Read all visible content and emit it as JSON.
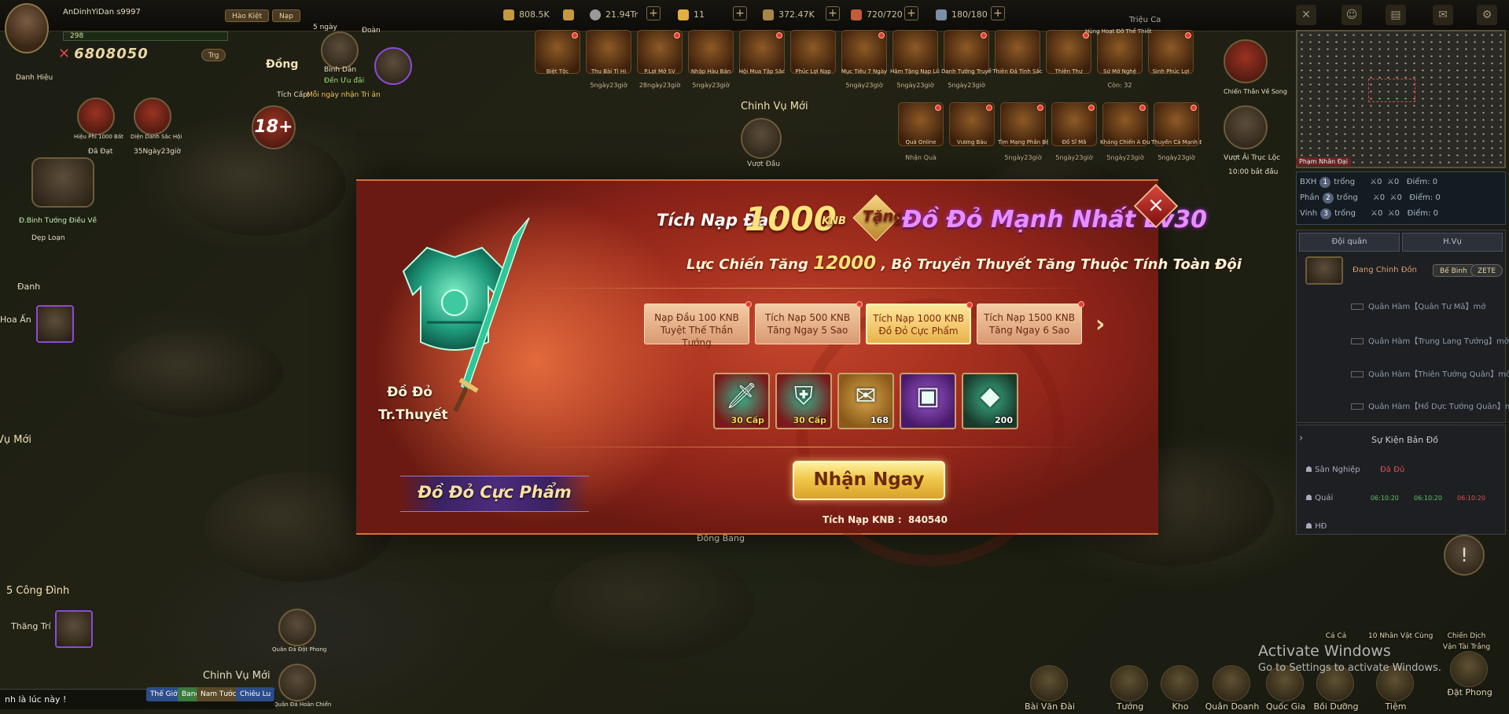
{
  "player": {
    "name": "AnDinhYiDan s9997",
    "level": "298",
    "power": "6808050",
    "tabs": [
      "Hào Kiệt",
      "Nạp"
    ],
    "title_btn": "Danh Hiệu",
    "power_btn": "Trg"
  },
  "resources": [
    {
      "value": "808.5K"
    },
    {
      "value": "21.94Tr"
    },
    {
      "value": "11"
    },
    {
      "value": "372.47K"
    },
    {
      "value": "720/720"
    },
    {
      "value": "180/180"
    }
  ],
  "left_labels": {
    "dong": "Đồng",
    "binh_dan": "Bình Dân",
    "uu_dai": "Đến Ưu đãi",
    "gift_note": "Mỗi ngày nhận Tri ân",
    "tich_cap": "Tích Cấp:",
    "ngay": "5 ngày",
    "doan": "Đoàn",
    "hero1": "Hiệu Phi 1000 Bất",
    "hero1_sub": "Đã Đạt",
    "hero2": "Diện Danh Sắc Hội",
    "hero2_sub": "35Ngày23giờ",
    "bang": "Đ.Binh Tướng Điều Về",
    "dep_loan": "Dẹp Loạn",
    "danh": "Đanh",
    "hoa_an": "Hoa Ấn",
    "chinh_vu_moi": "Chinh Vụ Mới",
    "vu_moi": "Vụ Mới",
    "cong_dinh": "Công Đình",
    "num5": "5",
    "thang_tri": "Thăng Trí",
    "quan_da_dot": "Quân Đá Đột Phong",
    "chinh_vu_moi2": "Chinh Vụ Mới",
    "quan_da_hoan": "Quân Đá Hoàn Chiến",
    "age": "18+",
    "vuot_dau": "Vượt Đầu"
  },
  "top_icons": {
    "row1": [
      {
        "label": "Biệt Tộc",
        "time": ""
      },
      {
        "label": "Thu Bài Tì Hi",
        "time": "5ngày23giờ"
      },
      {
        "label": "P.Lợi Mở SV",
        "time": "28ngày23giờ"
      },
      {
        "label": "Nhập Hàu Bán",
        "time": "5ngày23giờ"
      },
      {
        "label": "Hội Mua Tập Sắc",
        "time": ""
      },
      {
        "label": "Phúc Lợi Nạp",
        "time": ""
      },
      {
        "label": "Mục Tiêu 7 Ngày",
        "time": "5ngày23giờ"
      },
      {
        "label": "Hãm Tặng Nạp Lũ Kế",
        "time": "5ngày23giờ"
      },
      {
        "label": "Danh Tướng Truyền",
        "time": "5ngày23giờ"
      },
      {
        "label": "Thiên Đá Tinh Sắc",
        "time": ""
      },
      {
        "label": "Thiên Thư",
        "time": ""
      },
      {
        "label": "Sứ Mở Nghệ",
        "time": "Còn: 32"
      },
      {
        "label": "Sinh Phúc Lợi",
        "time": ""
      }
    ],
    "row1_extra": "Hùng Hoạt Đỡ Thể Thiết",
    "row2": [
      {
        "label": "Quà Online",
        "time": "Nhận Quà"
      },
      {
        "label": "Vương Bàu",
        "time": ""
      },
      {
        "label": "Tìm Mạng Phần Bện",
        "time": "5ngày23giờ"
      },
      {
        "label": "Đồ Sĩ Mã",
        "time": "5ngày23giờ"
      },
      {
        "label": "Kháng Chiến Á Đuổi",
        "time": "5ngày23giờ"
      },
      {
        "label": "Thuyền Cá Mạnh Bận",
        "time": "5ngày23giờ"
      }
    ],
    "right1": {
      "label": "Chiến Thắn Về Song",
      "time": ""
    },
    "right2": {
      "label": "Vượt Ải Trục Lộc",
      "time": "10:00 bắt đầu"
    },
    "dong_bang": "Đồng Bang",
    "trieu_ca": "Triệu Ca"
  },
  "minimap": {
    "btn": "Phạm Nhân Đại"
  },
  "rank": {
    "headers": [
      "BXH",
      "Phần",
      "Vinh"
    ],
    "rows": [
      {
        "n": "1",
        "name": "trống",
        "a": "0",
        "b": "0",
        "c": "Điểm: 0"
      },
      {
        "n": "2",
        "name": "trống",
        "a": "0",
        "b": "0",
        "c": "Điểm: 0"
      },
      {
        "n": "3",
        "name": "trống",
        "a": "0",
        "b": "0",
        "c": "Điểm: 0"
      }
    ]
  },
  "side_tabs": [
    "Đội quân",
    "H.Vụ"
  ],
  "army": {
    "title": "Đang Chinh Đồn",
    "btn1": "Bế Binh",
    "btn2": "ZETE",
    "items": [
      "Quân Hàm【Quân Tư Mã】mở",
      "Quân Hàm【Trung Lang Tướng】mở",
      "Quân Hàm【Thiên Tướng Quân】mở",
      "Quân Hàm【Hổ Dực Tướng Quân】mở"
    ]
  },
  "events": {
    "title": "Sự Kiện Bản Đồ",
    "rows": [
      {
        "label": "Sân Nghiệp",
        "v1": "Đã Đủ",
        "v2": "",
        "v3": ""
      },
      {
        "label": "Quái",
        "v1": "06:10:20",
        "v2": "06:10:20",
        "v3": "06:10:20"
      },
      {
        "label": "HĐ",
        "v1": "",
        "v2": "",
        "v3": ""
      }
    ]
  },
  "chat": {
    "text": "nh là lúc này !",
    "btns": [
      "Thế Giới",
      "Bang",
      "Nam Tước",
      "Chiêu Lu"
    ]
  },
  "bottom_bar": [
    "Bài Văn Đài",
    "Tướng",
    "Kho",
    "Quân Doanh",
    "Quốc Gia",
    "Bồi Dưỡng",
    "Tiệm",
    "Đặt Phong",
    "Chiến Dịch",
    "Vận Tài Trắng",
    "Cá Cả",
    "10 Nhân Vật Cùng"
  ],
  "modal": {
    "title_pre": "Tích Nạp Đạt",
    "title_amount": "1000",
    "title_unit": "KNB",
    "title_gift": "Tặng",
    "title_reward": "Đồ Đỏ Mạnh Nhất Lv30",
    "sub_pre": "Lực Chiến Tăng",
    "sub_num": "12000",
    "sub_post": ", Bộ Truyền Thuyết Tăng Thuộc Tính Toàn Đội",
    "item_name": "Đồ Đỏ Tr.Thuyết",
    "banner": "Đồ Đỏ Cực Phẩm",
    "tabs": [
      {
        "line1": "Nạp Đầu 100 KNB",
        "line2": "Tuyệt Thế Thần Tướng",
        "active": false
      },
      {
        "line1": "Tích Nạp 500 KNB",
        "line2": "Tăng Ngay 5 Sao",
        "active": false
      },
      {
        "line1": "Tích Nạp 1000 KNB",
        "line2": "Đồ Đỏ Cực Phẩm",
        "active": true
      },
      {
        "line1": "Tích Nạp 1500 KNB",
        "line2": "Tăng Ngay 6 Sao",
        "active": false
      }
    ],
    "rewards": [
      {
        "icon": "sword-icon",
        "count": "30 Cấp",
        "color": "#7a1a1a"
      },
      {
        "icon": "armor-icon",
        "count": "30 Cấp",
        "color": "#7a1a1a"
      },
      {
        "icon": "scroll-icon",
        "count": "168",
        "color": "#8a5a1a"
      },
      {
        "icon": "chest-icon",
        "count": "",
        "color": "#4a1a6a"
      },
      {
        "icon": "gem-icon",
        "count": "200",
        "color": "#1a3a2a"
      }
    ],
    "claim": "Nhận Ngay",
    "total_label": "Tích Nạp KNB :",
    "total_value": "840540"
  },
  "watermark": {
    "line1": "Activate Windows",
    "line2": "Go to Settings to activate Windows."
  }
}
